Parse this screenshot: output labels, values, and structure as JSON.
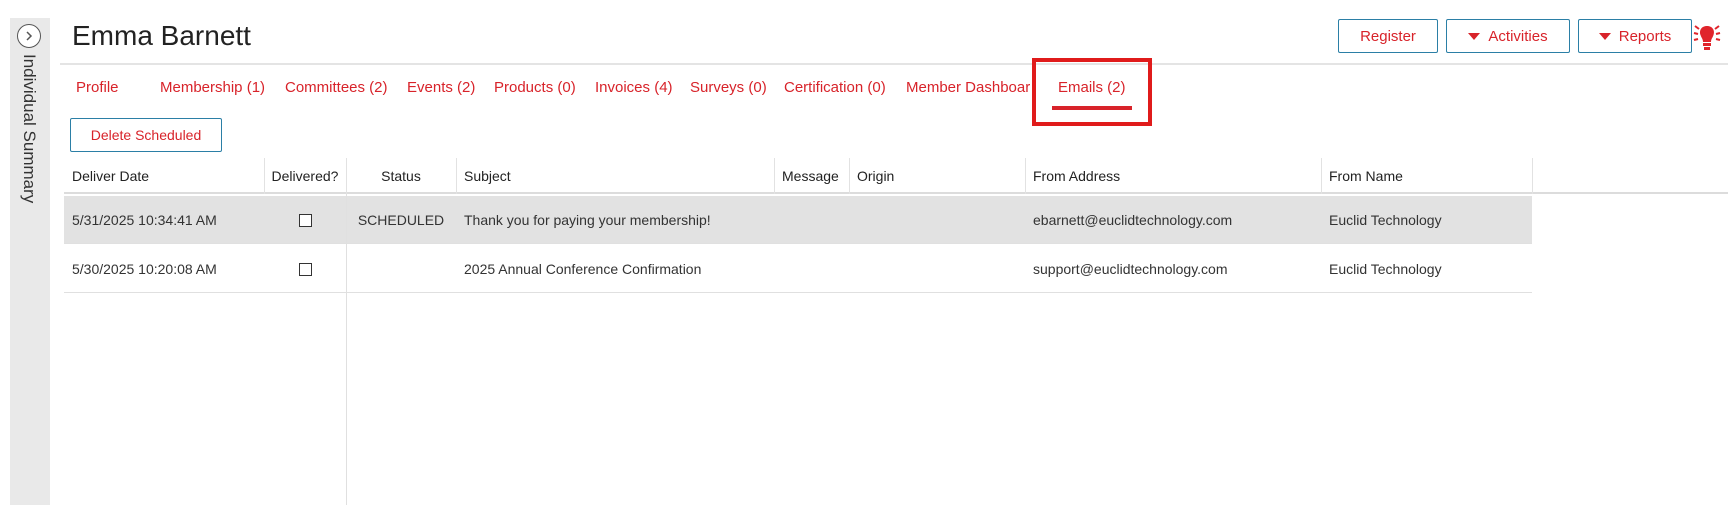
{
  "sidebar": {
    "label": "Individual Summary",
    "toggle_icon": "chevron-right-circle-icon"
  },
  "header": {
    "title": "Emma Barnett",
    "register_label": "Register",
    "activities_label": "Activities",
    "reports_label": "Reports",
    "bulb_icon": "lightbulb-icon"
  },
  "tabs": [
    {
      "label": "Profile"
    },
    {
      "label": "Membership (1)"
    },
    {
      "label": "Committees (2)"
    },
    {
      "label": "Events (2)"
    },
    {
      "label": "Products (0)"
    },
    {
      "label": "Invoices (4)"
    },
    {
      "label": "Surveys (0)"
    },
    {
      "label": "Certification (0)"
    },
    {
      "label": "Member Dashboard"
    },
    {
      "label": "Emails (2)",
      "active": true
    }
  ],
  "toolbar": {
    "delete_scheduled_label": "Delete Scheduled"
  },
  "grid": {
    "columns": [
      "Deliver Date",
      "Delivered?",
      "Status",
      "Subject",
      "Message",
      "Origin",
      "From Address",
      "From Name"
    ],
    "rows": [
      {
        "deliver_date": "5/31/2025 10:34:41 AM",
        "delivered": false,
        "status": "SCHEDULED",
        "subject": "Thank you for paying your membership!",
        "message": "",
        "origin": "",
        "from_address": "ebarnett@euclidtechnology.com",
        "from_name": "Euclid Technology",
        "selected": true
      },
      {
        "deliver_date": "5/30/2025 10:20:08 AM",
        "delivered": false,
        "status": "",
        "subject": "2025 Annual Conference Confirmation",
        "message": "",
        "origin": "",
        "from_address": "support@euclidtechnology.com",
        "from_name": "Euclid Technology",
        "selected": false
      }
    ]
  },
  "colors": {
    "accent_red": "#d8232a",
    "button_border": "#2b7fa6",
    "highlight_box": "#e01b1b"
  }
}
